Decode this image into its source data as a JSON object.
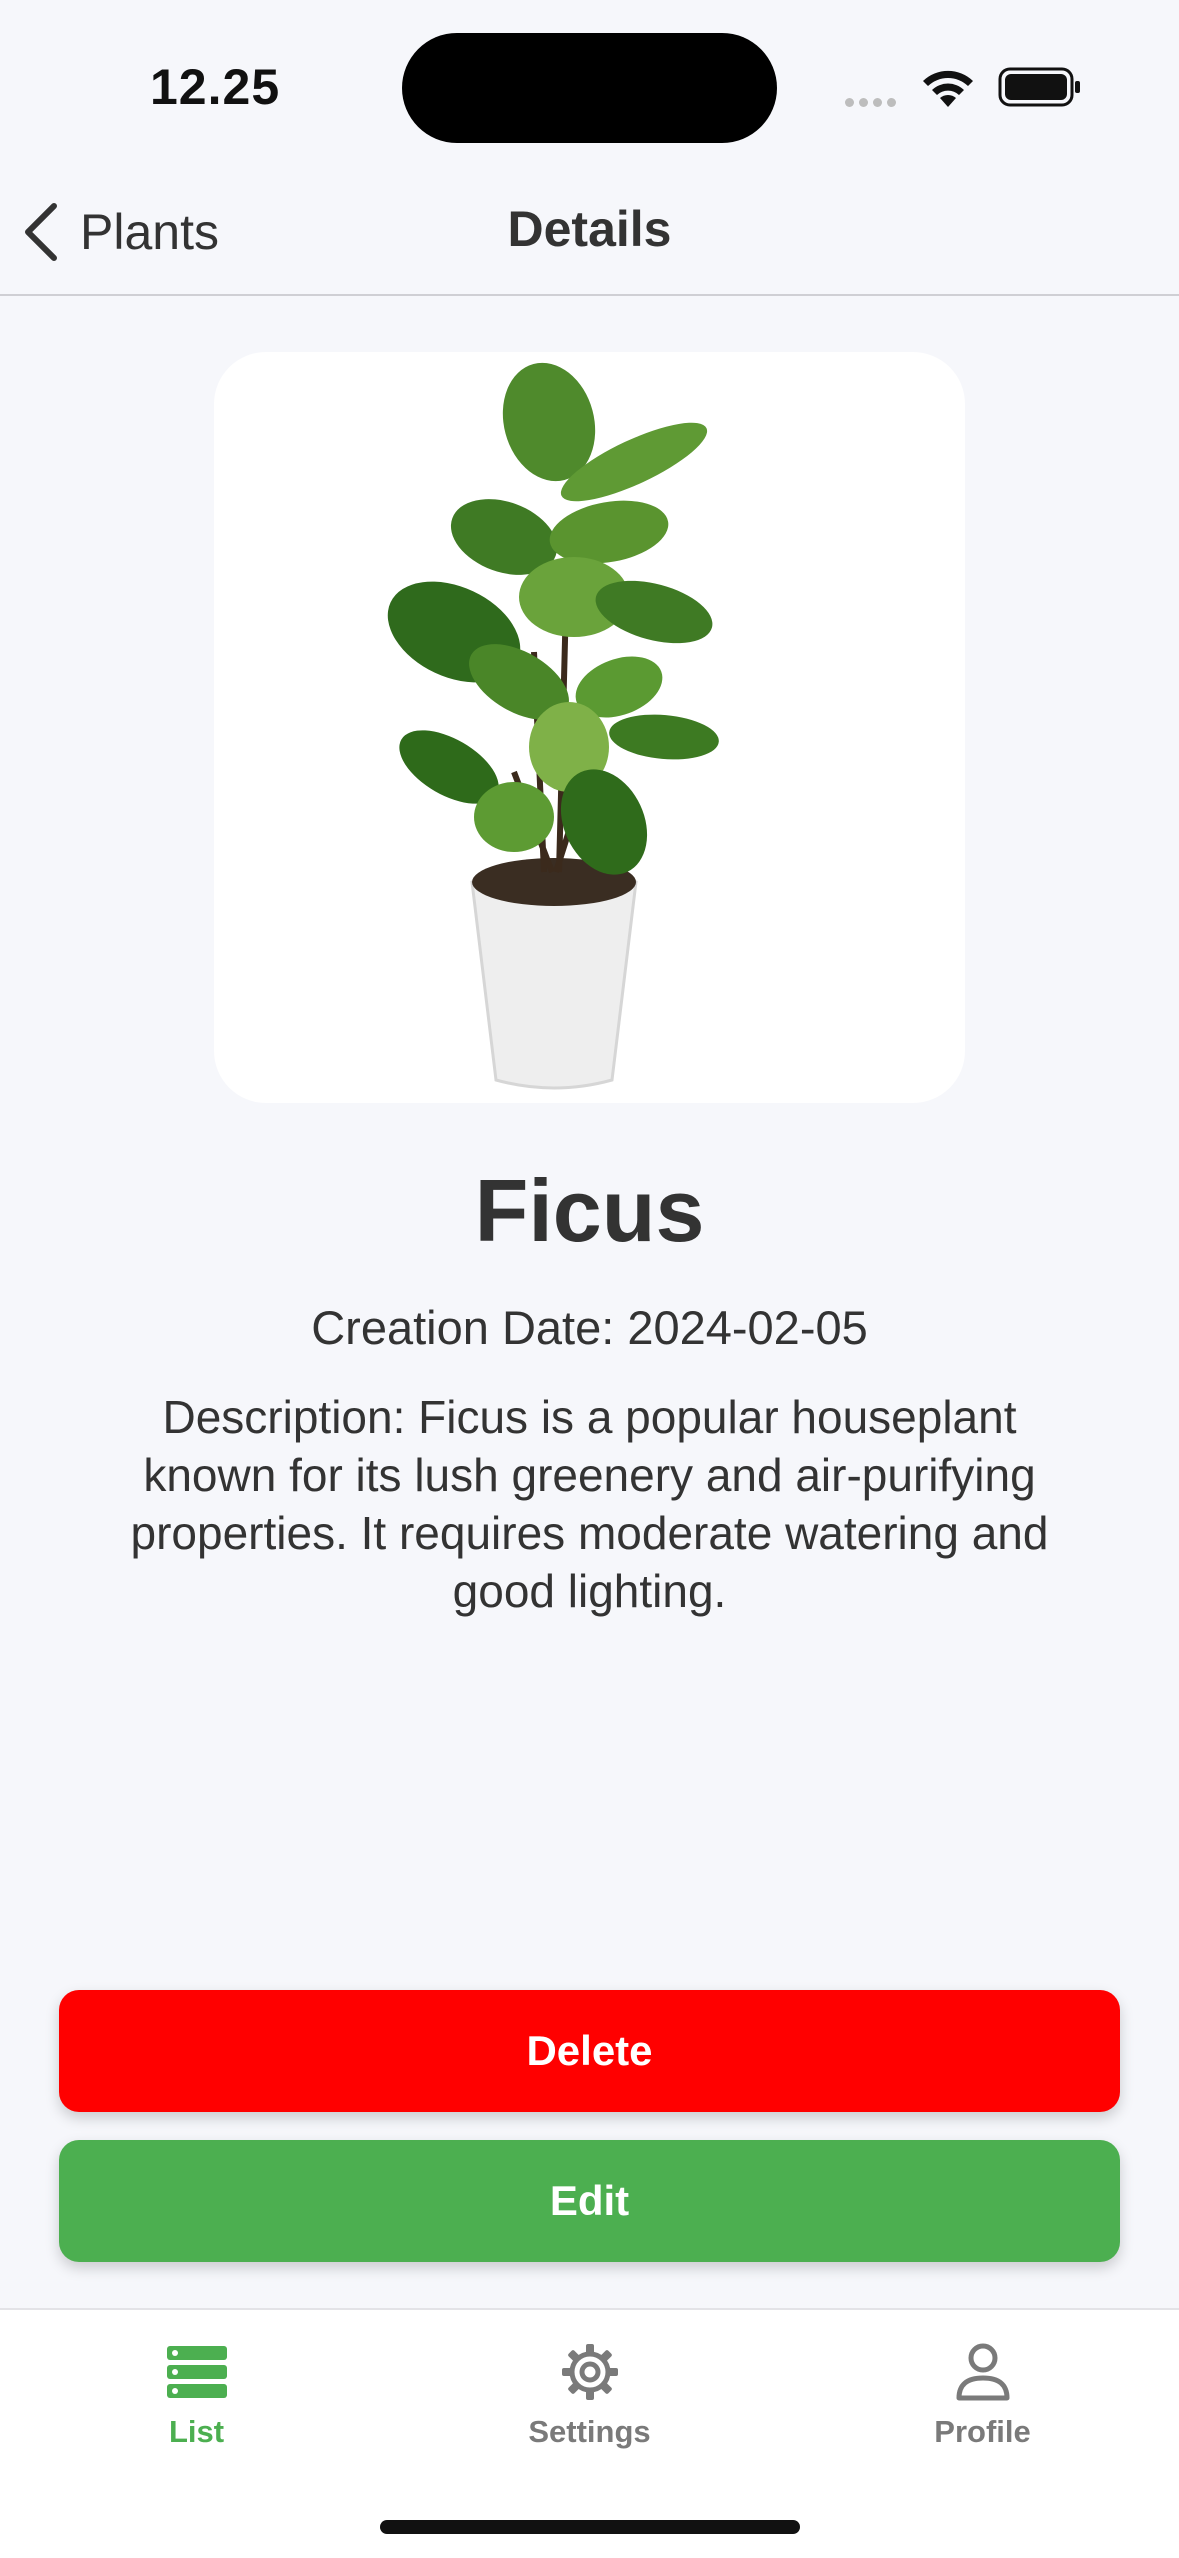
{
  "status_bar": {
    "time": "12.25"
  },
  "nav": {
    "back_label": "Plants",
    "title": "Details"
  },
  "plant": {
    "name": "Ficus",
    "creation_date": "Creation Date: 2024-02-05",
    "description": "Description: Ficus is a popular houseplant known for its lush greenery and air-purifying properties. It requires moderate watering and good lighting."
  },
  "actions": {
    "delete_label": "Delete",
    "edit_label": "Edit"
  },
  "tabs": [
    {
      "label": "List",
      "icon": "list-icon",
      "active": true
    },
    {
      "label": "Settings",
      "icon": "gear-icon",
      "active": false
    },
    {
      "label": "Profile",
      "icon": "person-icon",
      "active": false
    }
  ],
  "colors": {
    "accent": "#4caf50",
    "danger": "#ff0000",
    "inactive": "#7a7a7a",
    "background": "#f6f7fb"
  }
}
